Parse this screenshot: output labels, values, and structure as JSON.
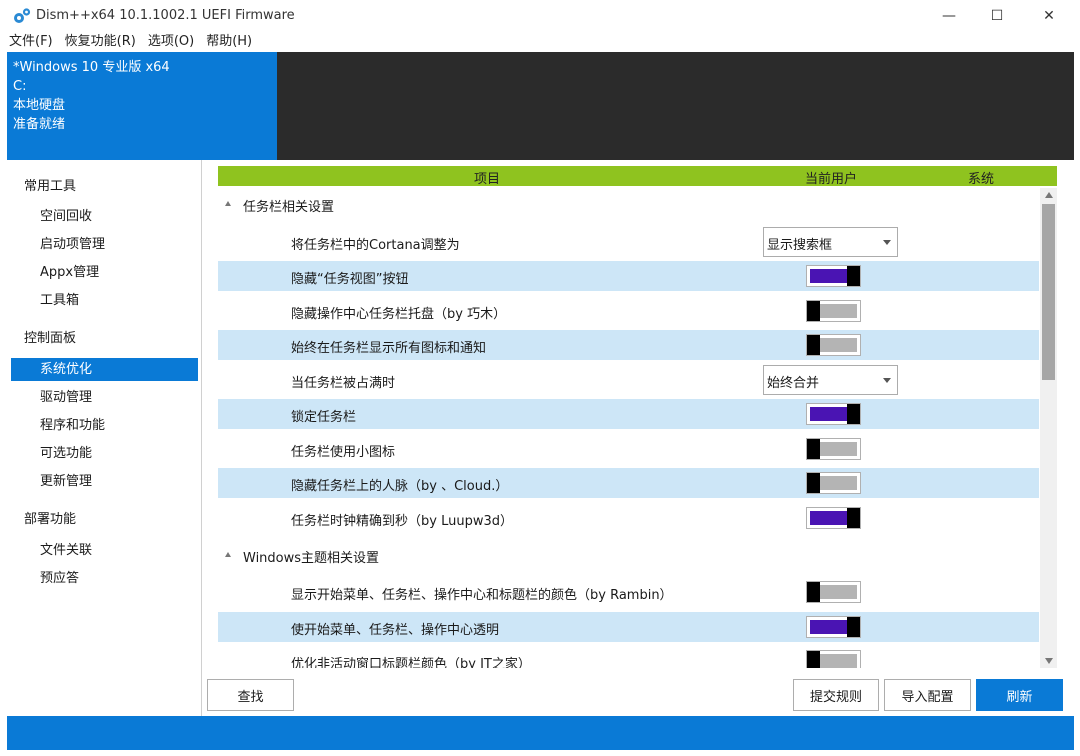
{
  "window": {
    "title": "Dism++x64 10.1.1002.1 UEFI Firmware",
    "minimize": "—",
    "maximize": "☐",
    "close": "✕"
  },
  "menu": [
    "文件(F)",
    "恢复功能(R)",
    "选项(O)",
    "帮助(H)"
  ],
  "info": {
    "os": "*Windows 10 专业版 x64",
    "drive": "C:",
    "disk": "本地硬盘",
    "status": "准备就绪"
  },
  "sidebar": {
    "categories": [
      "常用工具",
      "控制面板",
      "部署功能"
    ],
    "common_tools": [
      "空间回收",
      "启动项管理",
      "Appx管理",
      "工具箱"
    ],
    "control_panel": [
      "系统优化",
      "驱动管理",
      "程序和功能",
      "可选功能",
      "更新管理"
    ],
    "deploy": [
      "文件关联",
      "预应答"
    ],
    "active": "系统优化"
  },
  "table": {
    "headers": [
      "项目",
      "当前用户",
      "系统"
    ],
    "groups": [
      "任务栏相关设置",
      "Windows主题相关设置"
    ],
    "taskbar_rows": [
      {
        "label": "将任务栏中的Cortana调整为",
        "type": "dropdown",
        "value": "显示搜索框"
      },
      {
        "label": "隐藏“任务视图”按钮",
        "type": "toggle",
        "on": true
      },
      {
        "label": "隐藏操作中心任务栏托盘（by 巧木）",
        "type": "toggle",
        "on": false
      },
      {
        "label": "始终在任务栏显示所有图标和通知",
        "type": "toggle",
        "on": false
      },
      {
        "label": "当任务栏被占满时",
        "type": "dropdown",
        "value": "始终合并"
      },
      {
        "label": "锁定任务栏",
        "type": "toggle",
        "on": true
      },
      {
        "label": "任务栏使用小图标",
        "type": "toggle",
        "on": false
      },
      {
        "label": "隐藏任务栏上的人脉（by 、Cloud.）",
        "type": "toggle",
        "on": false
      },
      {
        "label": "任务栏时钟精确到秒（by Luupw3d）",
        "type": "toggle",
        "on": true
      }
    ],
    "theme_rows": [
      {
        "label": "显示开始菜单、任务栏、操作中心和标题栏的颜色（by Rambin）",
        "type": "toggle",
        "on": false
      },
      {
        "label": "使开始菜单、任务栏、操作中心透明",
        "type": "toggle",
        "on": true
      },
      {
        "label": "优化非活动窗口标题栏颜色（by IT之家）",
        "type": "toggle",
        "on": false
      }
    ]
  },
  "buttons": {
    "find": "查找",
    "submit": "提交规则",
    "import": "导入配置",
    "refresh": "刷新"
  },
  "colors": {
    "accent": "#0a7ad6",
    "header_green": "#8fc31f",
    "toggle_on": "#4a14b3",
    "row_alt": "#cde6f7"
  }
}
